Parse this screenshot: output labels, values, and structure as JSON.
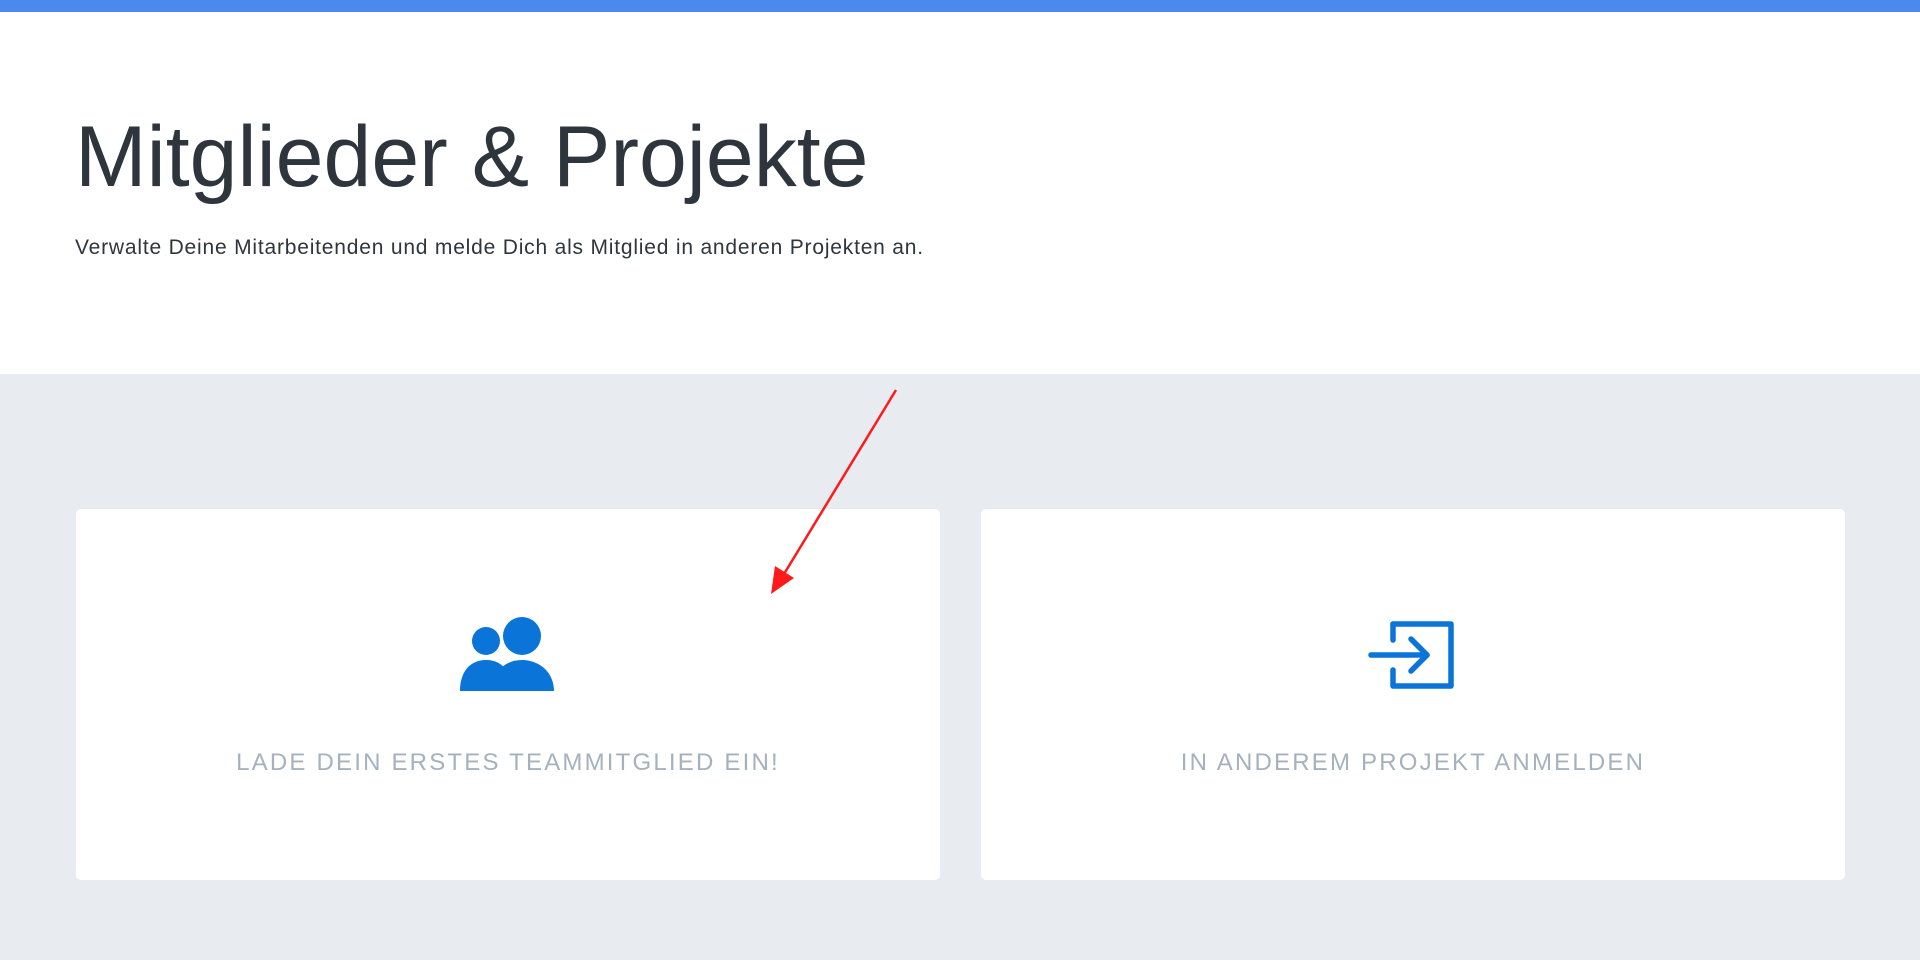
{
  "header": {
    "title": "Mitglieder & Projekte",
    "subtitle": "Verwalte Deine Mitarbeitenden und melde Dich als Mitglied in anderen Projekten an."
  },
  "cards": [
    {
      "label": "LADE DEIN ERSTES TEAMMITGLIED EIN!",
      "icon": "users-icon"
    },
    {
      "label": "IN ANDEREM PROJEKT ANMELDEN",
      "icon": "sign-in-icon"
    }
  ],
  "colors": {
    "accent_bar": "#4a89ee",
    "icon_blue": "#0a74d8",
    "title_text": "#2f353d",
    "card_label": "#a6b1be",
    "page_background": "#e8ebef",
    "annotation_arrow": "#ff1a1a"
  }
}
